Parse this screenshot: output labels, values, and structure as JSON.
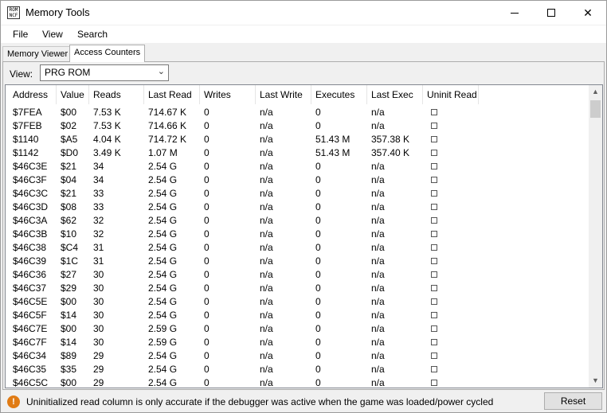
{
  "window": {
    "title": "Memory Tools",
    "app_icon_text": "ROM NCF"
  },
  "menubar": {
    "items": [
      "File",
      "View",
      "Search"
    ]
  },
  "tabs": [
    {
      "label": "Memory Viewer",
      "active": false
    },
    {
      "label": "Access Counters",
      "active": true
    }
  ],
  "view": {
    "label": "View:",
    "selected": "PRG ROM"
  },
  "table": {
    "columns": [
      "Address",
      "Value",
      "Reads",
      "Last Read",
      "Writes",
      "Last Write",
      "Executes",
      "Last Exec",
      "Uninit Read"
    ],
    "rows": [
      [
        "$7FEA",
        "$00",
        "7.53 K",
        "714.67 K",
        "0",
        "n/a",
        "0",
        "n/a",
        false
      ],
      [
        "$7FEB",
        "$02",
        "7.53 K",
        "714.66 K",
        "0",
        "n/a",
        "0",
        "n/a",
        false
      ],
      [
        "$1140",
        "$A5",
        "4.04 K",
        "714.72 K",
        "0",
        "n/a",
        "51.43 M",
        "357.38 K",
        false
      ],
      [
        "$1142",
        "$D0",
        "3.49 K",
        "1.07 M",
        "0",
        "n/a",
        "51.43 M",
        "357.40 K",
        false
      ],
      [
        "$46C3E",
        "$21",
        "34",
        "2.54 G",
        "0",
        "n/a",
        "0",
        "n/a",
        false
      ],
      [
        "$46C3F",
        "$04",
        "34",
        "2.54 G",
        "0",
        "n/a",
        "0",
        "n/a",
        false
      ],
      [
        "$46C3C",
        "$21",
        "33",
        "2.54 G",
        "0",
        "n/a",
        "0",
        "n/a",
        false
      ],
      [
        "$46C3D",
        "$08",
        "33",
        "2.54 G",
        "0",
        "n/a",
        "0",
        "n/a",
        false
      ],
      [
        "$46C3A",
        "$62",
        "32",
        "2.54 G",
        "0",
        "n/a",
        "0",
        "n/a",
        false
      ],
      [
        "$46C3B",
        "$10",
        "32",
        "2.54 G",
        "0",
        "n/a",
        "0",
        "n/a",
        false
      ],
      [
        "$46C38",
        "$C4",
        "31",
        "2.54 G",
        "0",
        "n/a",
        "0",
        "n/a",
        false
      ],
      [
        "$46C39",
        "$1C",
        "31",
        "2.54 G",
        "0",
        "n/a",
        "0",
        "n/a",
        false
      ],
      [
        "$46C36",
        "$27",
        "30",
        "2.54 G",
        "0",
        "n/a",
        "0",
        "n/a",
        false
      ],
      [
        "$46C37",
        "$29",
        "30",
        "2.54 G",
        "0",
        "n/a",
        "0",
        "n/a",
        false
      ],
      [
        "$46C5E",
        "$00",
        "30",
        "2.54 G",
        "0",
        "n/a",
        "0",
        "n/a",
        false
      ],
      [
        "$46C5F",
        "$14",
        "30",
        "2.54 G",
        "0",
        "n/a",
        "0",
        "n/a",
        false
      ],
      [
        "$46C7E",
        "$00",
        "30",
        "2.59 G",
        "0",
        "n/a",
        "0",
        "n/a",
        false
      ],
      [
        "$46C7F",
        "$14",
        "30",
        "2.59 G",
        "0",
        "n/a",
        "0",
        "n/a",
        false
      ],
      [
        "$46C34",
        "$89",
        "29",
        "2.54 G",
        "0",
        "n/a",
        "0",
        "n/a",
        false
      ],
      [
        "$46C35",
        "$35",
        "29",
        "2.54 G",
        "0",
        "n/a",
        "0",
        "n/a",
        false
      ],
      [
        "$46C5C",
        "$00",
        "29",
        "2.54 G",
        "0",
        "n/a",
        "0",
        "n/a",
        false
      ]
    ]
  },
  "status": {
    "message": "Uninitialized read column is only accurate if the debugger was active when the game was loaded/power cycled",
    "icon": "warning-icon",
    "icon_color": "#e07b14",
    "reset_label": "Reset"
  }
}
